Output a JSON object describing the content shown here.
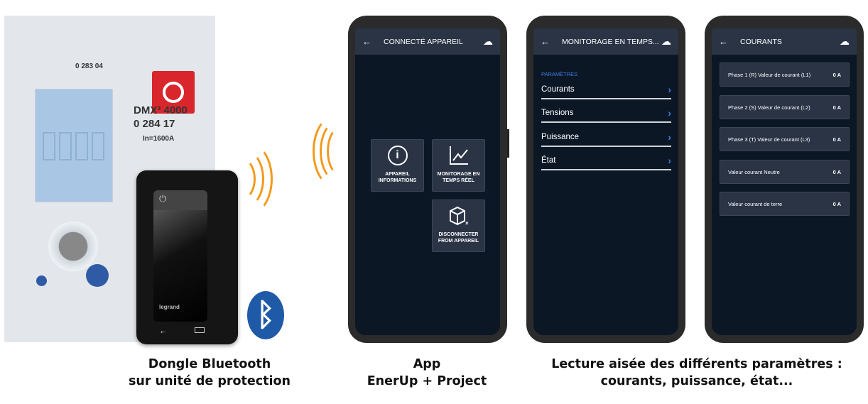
{
  "device_photo": {
    "lcd_ref": "0 283 04",
    "model": "DMX³ 4000",
    "ref": "0 284 17",
    "rating": "In=1600A",
    "dongle_brand": "legrand"
  },
  "phones": [
    {
      "header": {
        "back_icon": "arrow-left-icon",
        "title": "CONNECTÉ APPAREIL",
        "cloud_icon": "cloud-check-icon"
      },
      "tiles": [
        {
          "icon": "info-icon",
          "label": "APPAREIL INFORMATIONS"
        },
        {
          "icon": "line-chart-icon",
          "label": "MONITORAGE EN TEMPS RÉEL"
        },
        {
          "icon": "box-disconnect-icon",
          "label": "DISCONNECTER FROM APPAREIL"
        }
      ]
    },
    {
      "header": {
        "back_icon": "arrow-left-icon",
        "title": "MONITORAGE EN TEMPS...",
        "cloud_icon": "cloud-check-icon"
      },
      "section": "PARAMÈTRES",
      "items": [
        "Courants",
        "Tensions",
        "Puissance",
        "État"
      ]
    },
    {
      "header": {
        "back_icon": "arrow-left-icon",
        "title": "COURANTS",
        "cloud_icon": "cloud-check-icon"
      },
      "readings": [
        {
          "label": "Phase 1 (R) Valeur de courant (L1)",
          "value": "0 A"
        },
        {
          "label": "Phase 2 (S) Valeur de courant (L2)",
          "value": "0 A"
        },
        {
          "label": "Phase 3 (T) Valeur de courant (L3)",
          "value": "0 A"
        },
        {
          "label": "Valeur courant Neutre",
          "value": "0 A"
        },
        {
          "label": "Valeur courant de terre",
          "value": "0 A"
        }
      ]
    }
  ],
  "captions": {
    "dongle": [
      "Dongle Bluetooth",
      "sur unité de protection"
    ],
    "app": [
      "App",
      "EnerUp + Project"
    ],
    "reading": [
      "Lecture aisée des différents paramètres :",
      "courants, puissance, état..."
    ]
  },
  "colors": {
    "accent": "#3f7ee0",
    "signal": "#f39a1c",
    "screen_bg": "#0c1726",
    "header_bg": "#2a3445",
    "bluetooth": "#1f5aa8",
    "stop_button": "#d9262c"
  }
}
